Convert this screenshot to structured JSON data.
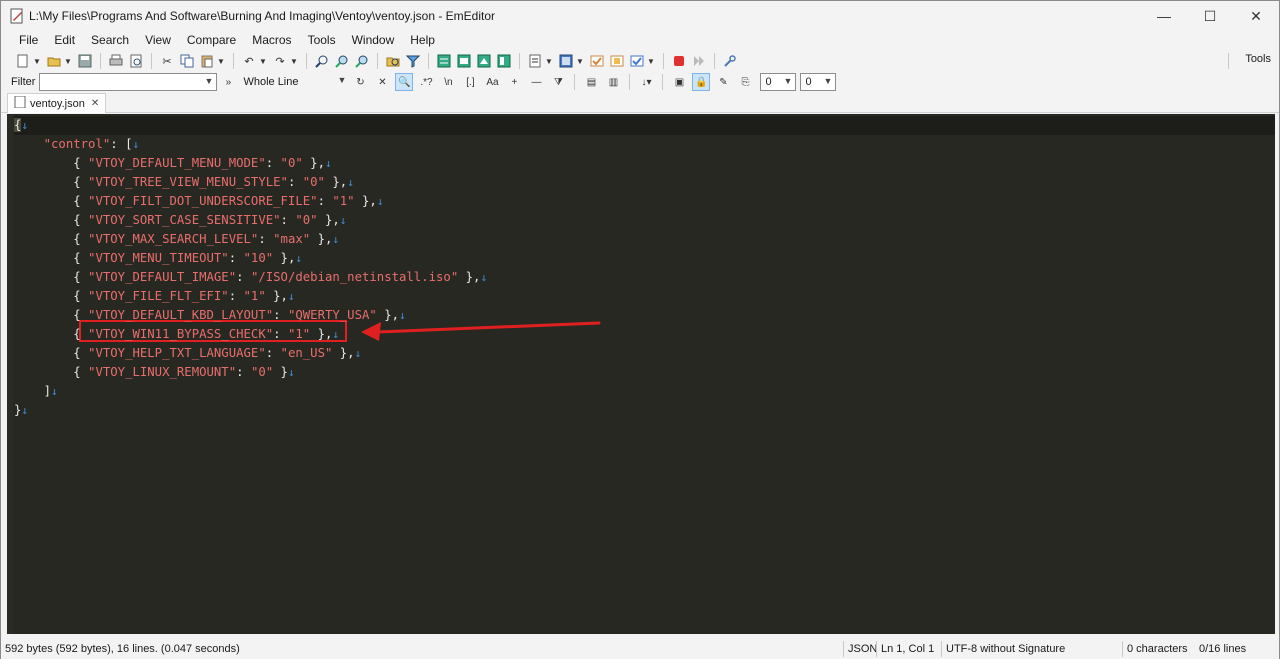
{
  "window": {
    "title": "L:\\My Files\\Programs And Software\\Burning And Imaging\\Ventoy\\ventoy.json - EmEditor",
    "minimize": "—",
    "maximize": "☐",
    "close": "✕"
  },
  "menu": {
    "items": [
      "File",
      "Edit",
      "Search",
      "View",
      "Compare",
      "Macros",
      "Tools",
      "Window",
      "Help"
    ]
  },
  "toolbar": {
    "tools_label": "Tools"
  },
  "filterbar": {
    "filter_label": "Filter",
    "filter_value": "",
    "scope_value": "Whole Line",
    "num1_value": "0",
    "num2_value": "0"
  },
  "tab": {
    "label": "ventoy.json"
  },
  "editor": {
    "lines": [
      {
        "indent": "",
        "open": "{",
        "key": "",
        "val": "",
        "close": ""
      },
      {
        "indent": "    ",
        "open": "",
        "key": "\"control\"",
        "val": "",
        "close": ": ["
      },
      {
        "indent": "        ",
        "open": "{ ",
        "key": "\"VTOY_DEFAULT_MENU_MODE\"",
        "sep": ": ",
        "val": "\"0\"",
        "close": " },"
      },
      {
        "indent": "        ",
        "open": "{ ",
        "key": "\"VTOY_TREE_VIEW_MENU_STYLE\"",
        "sep": ": ",
        "val": "\"0\"",
        "close": " },"
      },
      {
        "indent": "        ",
        "open": "{ ",
        "key": "\"VTOY_FILT_DOT_UNDERSCORE_FILE\"",
        "sep": ": ",
        "val": "\"1\"",
        "close": " },"
      },
      {
        "indent": "        ",
        "open": "{ ",
        "key": "\"VTOY_SORT_CASE_SENSITIVE\"",
        "sep": ": ",
        "val": "\"0\"",
        "close": " },"
      },
      {
        "indent": "        ",
        "open": "{ ",
        "key": "\"VTOY_MAX_SEARCH_LEVEL\"",
        "sep": ": ",
        "val": "\"max\"",
        "close": " },"
      },
      {
        "indent": "        ",
        "open": "{ ",
        "key": "\"VTOY_MENU_TIMEOUT\"",
        "sep": ": ",
        "val": "\"10\"",
        "close": " },"
      },
      {
        "indent": "        ",
        "open": "{ ",
        "key": "\"VTOY_DEFAULT_IMAGE\"",
        "sep": ": ",
        "val": "\"/ISO/debian_netinstall.iso\"",
        "close": " },"
      },
      {
        "indent": "        ",
        "open": "{ ",
        "key": "\"VTOY_FILE_FLT_EFI\"",
        "sep": ": ",
        "val": "\"1\"",
        "close": " },"
      },
      {
        "indent": "        ",
        "open": "{ ",
        "key": "\"VTOY_DEFAULT_KBD_LAYOUT\"",
        "sep": ": ",
        "val": "\"QWERTY_USA\"",
        "close": " },"
      },
      {
        "indent": "        ",
        "open": "{ ",
        "key": "\"VTOY_WIN11_BYPASS_CHECK\"",
        "sep": ": ",
        "val": "\"1\"",
        "close": " },"
      },
      {
        "indent": "        ",
        "open": "{ ",
        "key": "\"VTOY_HELP_TXT_LANGUAGE\"",
        "sep": ": ",
        "val": "\"en_US\"",
        "close": " },"
      },
      {
        "indent": "        ",
        "open": "{ ",
        "key": "\"VTOY_LINUX_REMOUNT\"",
        "sep": ": ",
        "val": "\"0\"",
        "close": " }"
      },
      {
        "indent": "    ",
        "open": "]",
        "key": "",
        "val": "",
        "close": ""
      },
      {
        "indent": "",
        "open": "}",
        "key": "",
        "val": "",
        "close": ""
      }
    ]
  },
  "status": {
    "size": "592 bytes (592 bytes), 16 lines. (0.047 seconds)",
    "mode": "JSON",
    "position": "Ln 1, Col 1",
    "encoding": "UTF-8 without Signature",
    "characters": "0 characters",
    "lines": "0/16 lines"
  },
  "colors": {
    "editor_bg": "#272822",
    "string": "#e86e6e",
    "eol_marker": "#3f8fd8",
    "annotation": "#e02020"
  }
}
